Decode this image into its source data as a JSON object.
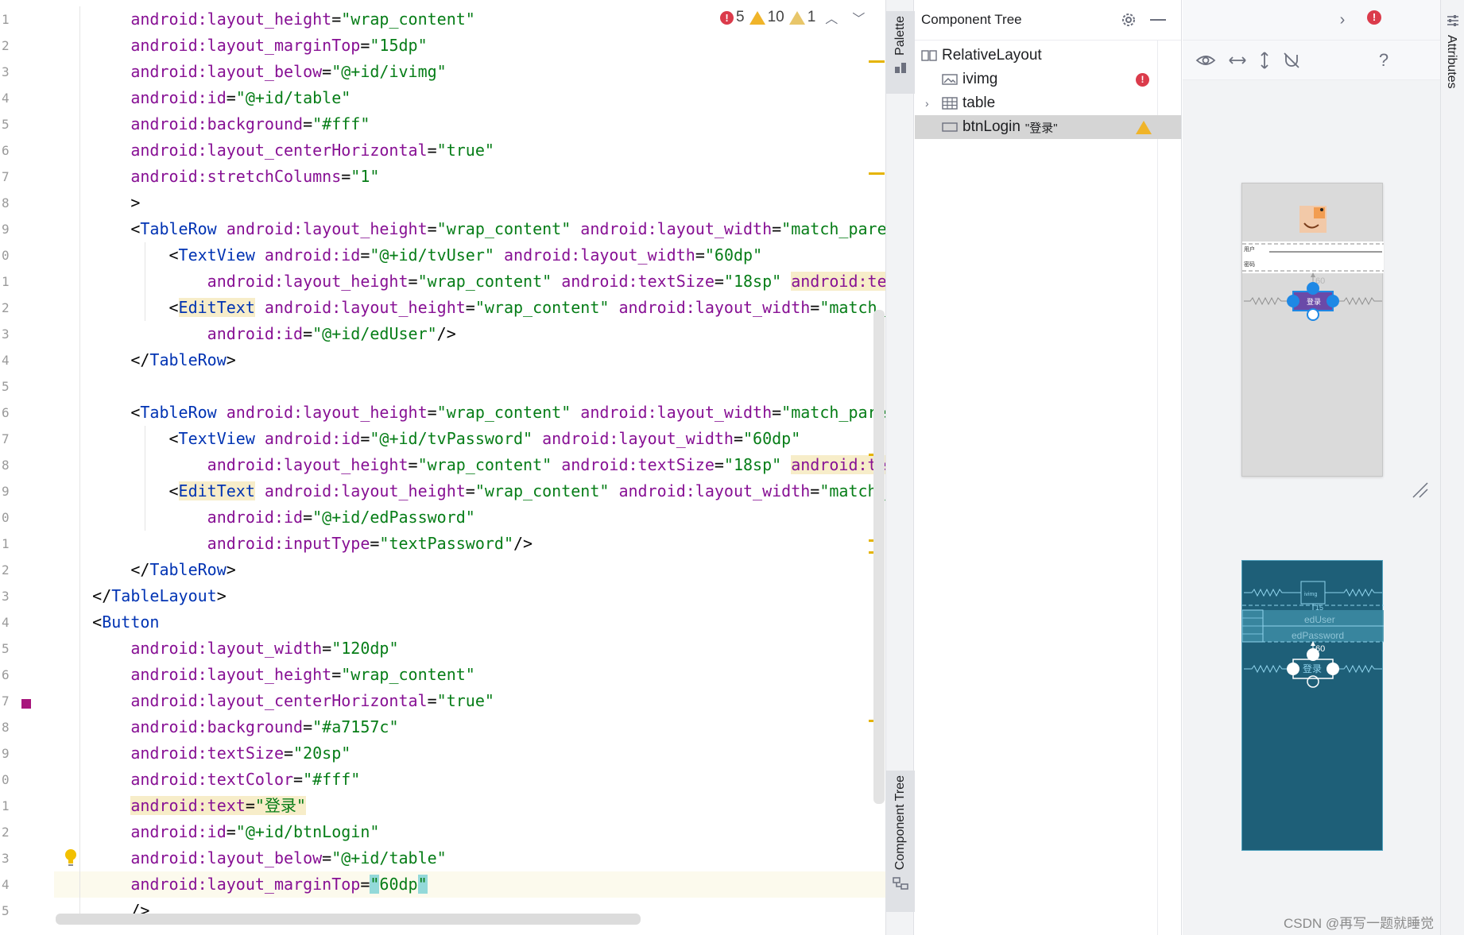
{
  "editor": {
    "line_numbers": [
      "1",
      "2",
      "3",
      "4",
      "5",
      "6",
      "7",
      "8",
      "9",
      "0",
      "1",
      "2",
      "3",
      "4",
      "5",
      "6",
      "7",
      "8",
      "9",
      "0",
      "1",
      "2",
      "3",
      "4",
      "5",
      "6",
      "7",
      "8",
      "9",
      "0",
      "1",
      "2",
      "3",
      "4",
      "5"
    ],
    "inspection": {
      "errors": "5",
      "warnings": "10",
      "weak_warnings": "1"
    },
    "lines": [
      [
        {
          "t": "        ",
          "c": "punct"
        },
        {
          "t": "android:layout_height",
          "c": "attr"
        },
        {
          "t": "=",
          "c": "punct"
        },
        {
          "t": "\"wrap_content\"",
          "c": "val"
        }
      ],
      [
        {
          "t": "        ",
          "c": "punct"
        },
        {
          "t": "android:layout_marginTop",
          "c": "attr"
        },
        {
          "t": "=",
          "c": "punct"
        },
        {
          "t": "\"15dp\"",
          "c": "val"
        }
      ],
      [
        {
          "t": "        ",
          "c": "punct"
        },
        {
          "t": "android:layout_below",
          "c": "attr"
        },
        {
          "t": "=",
          "c": "punct"
        },
        {
          "t": "\"@+id/ivimg\"",
          "c": "val"
        }
      ],
      [
        {
          "t": "        ",
          "c": "punct"
        },
        {
          "t": "android:id",
          "c": "attr"
        },
        {
          "t": "=",
          "c": "punct"
        },
        {
          "t": "\"@+id/table\"",
          "c": "val"
        }
      ],
      [
        {
          "t": "        ",
          "c": "punct"
        },
        {
          "t": "android:background",
          "c": "attr"
        },
        {
          "t": "=",
          "c": "punct"
        },
        {
          "t": "\"#fff\"",
          "c": "val"
        }
      ],
      [
        {
          "t": "        ",
          "c": "punct"
        },
        {
          "t": "android:layout_centerHorizontal",
          "c": "attr"
        },
        {
          "t": "=",
          "c": "punct"
        },
        {
          "t": "\"true\"",
          "c": "val"
        }
      ],
      [
        {
          "t": "        ",
          "c": "punct"
        },
        {
          "t": "android:stretchColumns",
          "c": "attr"
        },
        {
          "t": "=",
          "c": "punct"
        },
        {
          "t": "\"1\"",
          "c": "val"
        }
      ],
      [
        {
          "t": "        >",
          "c": "punct"
        }
      ],
      [
        {
          "t": "        <",
          "c": "punct"
        },
        {
          "t": "TableRow",
          "c": "tag"
        },
        {
          "t": " ",
          "c": "punct"
        },
        {
          "t": "android:layout_height",
          "c": "attr"
        },
        {
          "t": "=",
          "c": "punct"
        },
        {
          "t": "\"wrap_content\"",
          "c": "val"
        },
        {
          "t": " ",
          "c": "punct"
        },
        {
          "t": "android:layout_width",
          "c": "attr"
        },
        {
          "t": "=",
          "c": "punct"
        },
        {
          "t": "\"match_pare",
          "c": "val"
        }
      ],
      [
        {
          "t": "            <",
          "c": "punct"
        },
        {
          "t": "TextView",
          "c": "tag"
        },
        {
          "t": " ",
          "c": "punct"
        },
        {
          "t": "android:id",
          "c": "attr"
        },
        {
          "t": "=",
          "c": "punct"
        },
        {
          "t": "\"@+id/tvUser\"",
          "c": "val"
        },
        {
          "t": " ",
          "c": "punct"
        },
        {
          "t": "android:layout_width",
          "c": "attr"
        },
        {
          "t": "=",
          "c": "punct"
        },
        {
          "t": "\"60dp\"",
          "c": "val"
        }
      ],
      [
        {
          "t": "                ",
          "c": "punct"
        },
        {
          "t": "android:layout_height",
          "c": "attr"
        },
        {
          "t": "=",
          "c": "punct"
        },
        {
          "t": "\"wrap_content\"",
          "c": "val"
        },
        {
          "t": " ",
          "c": "punct"
        },
        {
          "t": "android:textSize",
          "c": "attr"
        },
        {
          "t": "=",
          "c": "punct"
        },
        {
          "t": "\"18sp\"",
          "c": "val"
        },
        {
          "t": " ",
          "c": "punct"
        },
        {
          "t": "android:te",
          "c": "attr hl"
        }
      ],
      [
        {
          "t": "            <",
          "c": "punct"
        },
        {
          "t": "EditText",
          "c": "tag hl"
        },
        {
          "t": " ",
          "c": "punct"
        },
        {
          "t": "android:layout_height",
          "c": "attr"
        },
        {
          "t": "=",
          "c": "punct"
        },
        {
          "t": "\"wrap_content\"",
          "c": "val"
        },
        {
          "t": " ",
          "c": "punct"
        },
        {
          "t": "android:layout_width",
          "c": "attr"
        },
        {
          "t": "=",
          "c": "punct"
        },
        {
          "t": "\"match_",
          "c": "val"
        }
      ],
      [
        {
          "t": "                ",
          "c": "punct"
        },
        {
          "t": "android:id",
          "c": "attr"
        },
        {
          "t": "=",
          "c": "punct"
        },
        {
          "t": "\"@+id/edUser\"",
          "c": "val"
        },
        {
          "t": "/>",
          "c": "punct"
        }
      ],
      [
        {
          "t": "        </",
          "c": "punct"
        },
        {
          "t": "TableRow",
          "c": "tag"
        },
        {
          "t": ">",
          "c": "punct"
        }
      ],
      [
        {
          "t": "",
          "c": "punct"
        }
      ],
      [
        {
          "t": "        <",
          "c": "punct"
        },
        {
          "t": "TableRow",
          "c": "tag"
        },
        {
          "t": " ",
          "c": "punct"
        },
        {
          "t": "android:layout_height",
          "c": "attr"
        },
        {
          "t": "=",
          "c": "punct"
        },
        {
          "t": "\"wrap_content\"",
          "c": "val"
        },
        {
          "t": " ",
          "c": "punct"
        },
        {
          "t": "android:layout_width",
          "c": "attr"
        },
        {
          "t": "=",
          "c": "punct"
        },
        {
          "t": "\"match_pare",
          "c": "val"
        }
      ],
      [
        {
          "t": "            <",
          "c": "punct"
        },
        {
          "t": "TextView",
          "c": "tag"
        },
        {
          "t": " ",
          "c": "punct"
        },
        {
          "t": "android:id",
          "c": "attr"
        },
        {
          "t": "=",
          "c": "punct"
        },
        {
          "t": "\"@+id/tvPassword\"",
          "c": "val"
        },
        {
          "t": " ",
          "c": "punct"
        },
        {
          "t": "android:layout_width",
          "c": "attr"
        },
        {
          "t": "=",
          "c": "punct"
        },
        {
          "t": "\"60dp\"",
          "c": "val"
        }
      ],
      [
        {
          "t": "                ",
          "c": "punct"
        },
        {
          "t": "android:layout_height",
          "c": "attr"
        },
        {
          "t": "=",
          "c": "punct"
        },
        {
          "t": "\"wrap_content\"",
          "c": "val"
        },
        {
          "t": " ",
          "c": "punct"
        },
        {
          "t": "android:textSize",
          "c": "attr"
        },
        {
          "t": "=",
          "c": "punct"
        },
        {
          "t": "\"18sp\"",
          "c": "val"
        },
        {
          "t": " ",
          "c": "punct"
        },
        {
          "t": "android:te",
          "c": "attr hl"
        }
      ],
      [
        {
          "t": "            <",
          "c": "punct"
        },
        {
          "t": "EditText",
          "c": "tag hl"
        },
        {
          "t": " ",
          "c": "punct"
        },
        {
          "t": "android:layout_height",
          "c": "attr"
        },
        {
          "t": "=",
          "c": "punct"
        },
        {
          "t": "\"wrap_content\"",
          "c": "val"
        },
        {
          "t": " ",
          "c": "punct"
        },
        {
          "t": "android:layout_width",
          "c": "attr"
        },
        {
          "t": "=",
          "c": "punct"
        },
        {
          "t": "\"match_",
          "c": "val"
        }
      ],
      [
        {
          "t": "                ",
          "c": "punct"
        },
        {
          "t": "android:id",
          "c": "attr"
        },
        {
          "t": "=",
          "c": "punct"
        },
        {
          "t": "\"@+id/edPassword\"",
          "c": "val"
        }
      ],
      [
        {
          "t": "                ",
          "c": "punct"
        },
        {
          "t": "android:inputType",
          "c": "attr"
        },
        {
          "t": "=",
          "c": "punct"
        },
        {
          "t": "\"textPassword\"",
          "c": "val"
        },
        {
          "t": "/>",
          "c": "punct"
        }
      ],
      [
        {
          "t": "        </",
          "c": "punct"
        },
        {
          "t": "TableRow",
          "c": "tag"
        },
        {
          "t": ">",
          "c": "punct"
        }
      ],
      [
        {
          "t": "    </",
          "c": "punct"
        },
        {
          "t": "TableLayout",
          "c": "tag"
        },
        {
          "t": ">",
          "c": "punct"
        }
      ],
      [
        {
          "t": "    <",
          "c": "punct"
        },
        {
          "t": "Button",
          "c": "tag"
        }
      ],
      [
        {
          "t": "        ",
          "c": "punct"
        },
        {
          "t": "android:layout_width",
          "c": "attr"
        },
        {
          "t": "=",
          "c": "punct"
        },
        {
          "t": "\"120dp\"",
          "c": "val"
        }
      ],
      [
        {
          "t": "        ",
          "c": "punct"
        },
        {
          "t": "android:layout_height",
          "c": "attr"
        },
        {
          "t": "=",
          "c": "punct"
        },
        {
          "t": "\"wrap_content\"",
          "c": "val"
        }
      ],
      [
        {
          "t": "        ",
          "c": "punct"
        },
        {
          "t": "android:layout_centerHorizontal",
          "c": "attr"
        },
        {
          "t": "=",
          "c": "punct"
        },
        {
          "t": "\"true\"",
          "c": "val"
        }
      ],
      [
        {
          "t": "        ",
          "c": "punct"
        },
        {
          "t": "android:background",
          "c": "attr"
        },
        {
          "t": "=",
          "c": "punct"
        },
        {
          "t": "\"#a7157c\"",
          "c": "val"
        }
      ],
      [
        {
          "t": "        ",
          "c": "punct"
        },
        {
          "t": "android:textSize",
          "c": "attr"
        },
        {
          "t": "=",
          "c": "punct"
        },
        {
          "t": "\"20sp\"",
          "c": "val"
        }
      ],
      [
        {
          "t": "        ",
          "c": "punct"
        },
        {
          "t": "android:textColor",
          "c": "attr"
        },
        {
          "t": "=",
          "c": "punct"
        },
        {
          "t": "\"#fff\"",
          "c": "val"
        }
      ],
      [
        {
          "t": "        ",
          "c": "punct"
        },
        {
          "t": "android:text",
          "c": "attr hl"
        },
        {
          "t": "=",
          "c": "punct hl"
        },
        {
          "t": "\"登录\"",
          "c": "val hl"
        }
      ],
      [
        {
          "t": "        ",
          "c": "punct"
        },
        {
          "t": "android:id",
          "c": "attr"
        },
        {
          "t": "=",
          "c": "punct"
        },
        {
          "t": "\"@+id/btnLogin\"",
          "c": "val"
        }
      ],
      [
        {
          "t": "        ",
          "c": "punct"
        },
        {
          "t": "android:layout_below",
          "c": "attr"
        },
        {
          "t": "=",
          "c": "punct"
        },
        {
          "t": "\"@+id/table\"",
          "c": "val"
        }
      ],
      [
        {
          "t": "        ",
          "c": "punct"
        },
        {
          "t": "android:layout_marginTop",
          "c": "attr"
        },
        {
          "t": "=",
          "c": "punct"
        },
        {
          "t": "\"",
          "c": "val caret-hl"
        },
        {
          "t": "60dp",
          "c": "val"
        },
        {
          "t": "\"",
          "c": "val caret-hl"
        }
      ],
      [
        {
          "t": "        />",
          "c": "punct"
        }
      ]
    ],
    "button_background_color": "#a7157c"
  },
  "toolstrip": {
    "palette_label": "Palette",
    "component_tree_label": "Component Tree"
  },
  "component_tree": {
    "title": "Component Tree",
    "nodes": [
      {
        "label": "RelativeLayout",
        "icon": "relative-layout-icon",
        "badge": ""
      },
      {
        "label": "ivimg",
        "icon": "image-view-icon",
        "badge": "error"
      },
      {
        "label": "table",
        "icon": "table-layout-icon",
        "badge": ""
      },
      {
        "label": "btnLogin",
        "text": "\"登录\"",
        "icon": "button-icon",
        "badge": "warning"
      }
    ]
  },
  "design": {
    "preview": {
      "user_label": "用户",
      "password_label": "密码",
      "margin_label": "60",
      "button_text": "登录"
    },
    "blueprint": {
      "ivimg_label": "ivimg",
      "margin_top_label": "15",
      "eduser_label": "edUser",
      "edpassword_label": "edPassword",
      "margin_label": "60",
      "button_label": "登录"
    },
    "help_label": "?"
  },
  "attributes": {
    "label": "Attributes"
  },
  "watermark": "CSDN @再写一题就睡觉",
  "colors": {
    "error": "#db3b4b",
    "warning": "#f0b429",
    "selection_handle": "#1e88e5",
    "blueprint_bg": "#1e5f78",
    "button_bg": "#a7157c"
  }
}
